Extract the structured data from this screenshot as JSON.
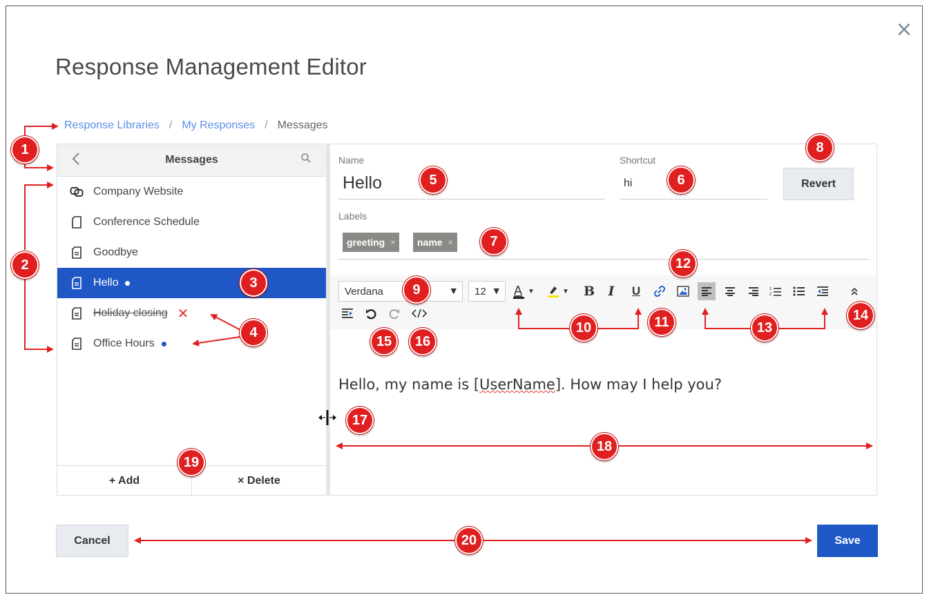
{
  "dialog": {
    "title": "Response Management Editor",
    "close_glyph": "×"
  },
  "breadcrumb": {
    "items": [
      "Response Libraries",
      "My Responses",
      "Messages"
    ],
    "separator": "/"
  },
  "messages_panel": {
    "title": "Messages",
    "back_glyph": "<",
    "items": [
      {
        "label": "Company Website",
        "icon": "link-icon",
        "state": "normal"
      },
      {
        "label": "Conference Schedule",
        "icon": "document-icon",
        "state": "normal"
      },
      {
        "label": "Goodbye",
        "icon": "text-document-icon",
        "state": "normal"
      },
      {
        "label": "Hello",
        "icon": "text-document-icon",
        "state": "selected-unsaved"
      },
      {
        "label": "Holiday closing",
        "icon": "text-document-icon",
        "state": "deleted"
      },
      {
        "label": "Office Hours",
        "icon": "text-document-icon",
        "state": "unsaved"
      }
    ],
    "add_label": "+ Add",
    "delete_label": "× Delete"
  },
  "editor": {
    "name_label": "Name",
    "name_value": "Hello",
    "shortcut_label": "Shortcut",
    "shortcut_value": "hi",
    "revert_label": "Revert",
    "labels_label": "Labels",
    "tags": [
      "greeting",
      "name"
    ],
    "tag_remove_glyph": "×",
    "font_family": "Verdana",
    "font_size": "12",
    "body_text_before": "Hello, my name is [",
    "body_text_token": "UserName",
    "body_text_after": "]. How may I help you?"
  },
  "toolbar": {
    "bold": "B",
    "italic": "I",
    "underline": "U",
    "text_color": "A"
  },
  "footer": {
    "cancel_label": "Cancel",
    "save_label": "Save"
  },
  "callouts": [
    "1",
    "2",
    "3",
    "4",
    "5",
    "6",
    "7",
    "8",
    "9",
    "10",
    "11",
    "12",
    "13",
    "14",
    "15",
    "16",
    "17",
    "18",
    "19",
    "20"
  ],
  "colors": {
    "accent": "#1f58c6",
    "link": "#5c8ee6",
    "annotation_red": "#e02020",
    "tag_bg": "#8a8a86"
  }
}
